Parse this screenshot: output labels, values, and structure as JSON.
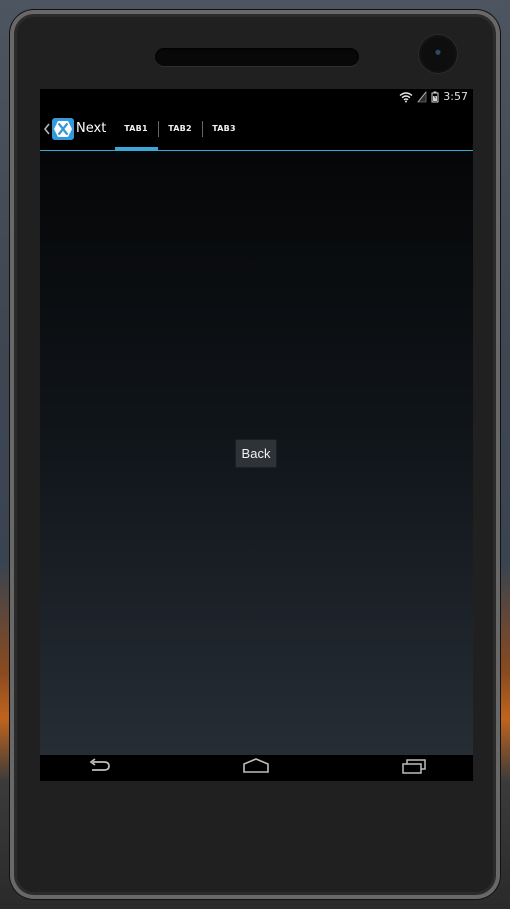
{
  "status_bar": {
    "time": "3:57"
  },
  "action_bar": {
    "title": "Next",
    "tabs": [
      {
        "label": "TAB1",
        "active": true
      },
      {
        "label": "TAB2",
        "active": false
      },
      {
        "label": "TAB3",
        "active": false
      }
    ],
    "accent_color": "#3aa7d7",
    "app_icon_color": "#3498db"
  },
  "content": {
    "back_button_label": "Back"
  },
  "icons": {
    "up_chevron": "chevron-left-icon",
    "app_icon": "xamarin-x-icon",
    "wifi": "wifi-icon",
    "signal": "signal-icon",
    "battery": "battery-icon",
    "nav_back": "back-arrow-icon",
    "nav_home": "home-icon",
    "nav_recents": "recents-icon"
  }
}
